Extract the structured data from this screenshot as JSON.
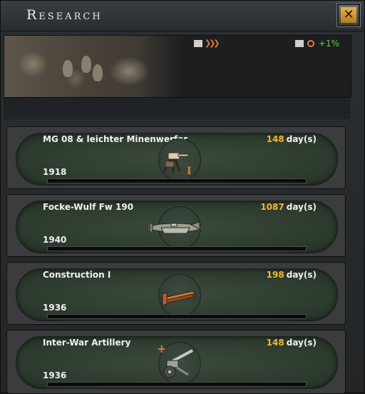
{
  "window": {
    "title": "Research"
  },
  "banner": {
    "bonus": "+1%"
  },
  "slots": [
    {
      "name": "MG 08 & leichter Minenwerfer",
      "days": "148",
      "days_unit": "day(s)",
      "year": "1918",
      "progress": 0,
      "icon": "machine-gun-icon",
      "badge": "I"
    },
    {
      "name": "Focke-Wulf Fw 190",
      "days": "1087",
      "days_unit": "day(s)",
      "year": "1940",
      "progress": 0,
      "icon": "fighter-plane-icon"
    },
    {
      "name": "Construction I",
      "days": "198",
      "days_unit": "day(s)",
      "year": "1936",
      "progress": 0,
      "icon": "steel-beam-icon"
    },
    {
      "name": "Inter-War Artillery",
      "days": "148",
      "days_unit": "day(s)",
      "year": "1936",
      "progress": 0,
      "icon": "artillery-icon",
      "badge": "+"
    }
  ],
  "colors": {
    "days_number": "#f3b631",
    "bonus": "#5fcf4a",
    "accent_orange": "#e2783a"
  }
}
